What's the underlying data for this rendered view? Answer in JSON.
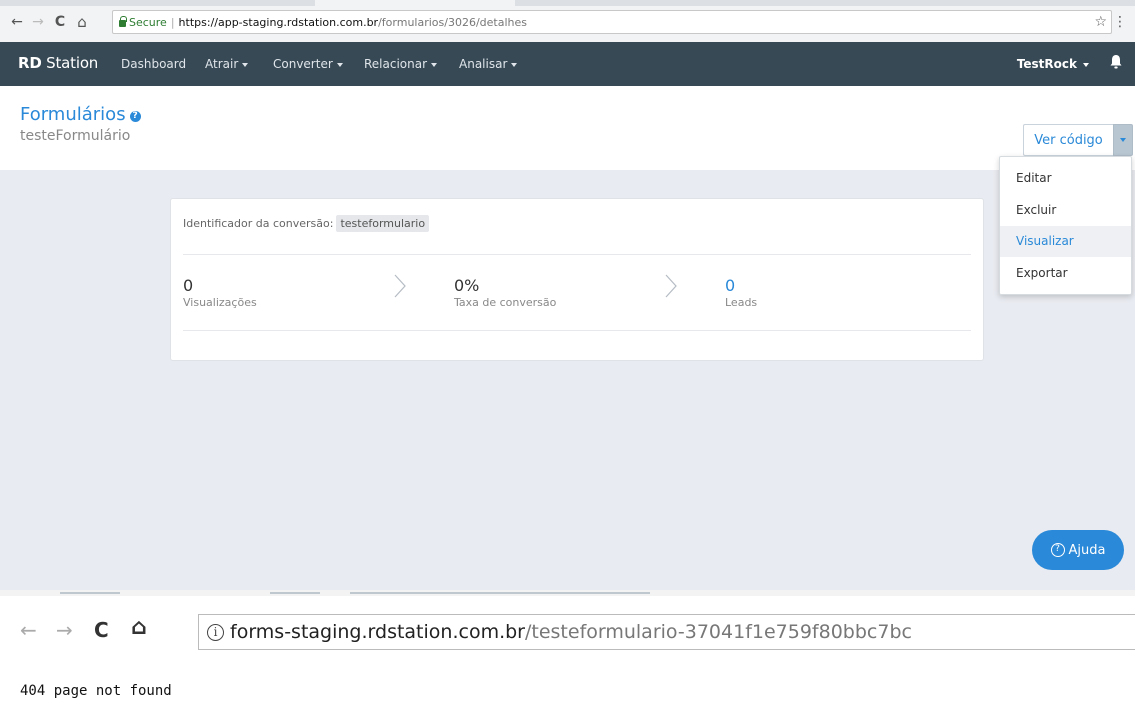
{
  "browser": {
    "secure_label": "Secure",
    "url_host": "https://app-staging.rdstation.com.br",
    "url_path": "/formularios/3026/detalhes",
    "back": "←",
    "forward": "→",
    "reload": "C",
    "home": "⌂",
    "star": "☆",
    "menu": "⋮"
  },
  "appbar": {
    "brand_bold": "RD",
    "brand_rest": " Station",
    "nav": [
      "Dashboard",
      "Atrair",
      "Converter",
      "Relacionar",
      "Analisar"
    ],
    "user": "TestRock"
  },
  "header": {
    "title": "Formulários",
    "help_glyph": "?",
    "subtitle": "testeFormulário",
    "action_label": "Ver código"
  },
  "dropdown": {
    "items": [
      "Editar",
      "Excluir",
      "Visualizar",
      "Exportar"
    ],
    "active_index": 2
  },
  "card": {
    "conversion_label": "Identificador da conversão:",
    "conversion_id": "testeformulario",
    "metrics": [
      {
        "value": "0",
        "label": "Visualizações"
      },
      {
        "value": "0%",
        "label": "Taxa de conversão"
      },
      {
        "value": "0",
        "label": "Leads"
      }
    ]
  },
  "help_button": {
    "glyph": "?",
    "label": "Ajuda"
  },
  "browser2": {
    "info_glyph": "i",
    "url_host": "forms-staging.rdstation.com.br",
    "url_path": "/testeformulario-37041f1e759f80bbc7bc",
    "back": "←",
    "forward": "→",
    "reload": "C",
    "home": "⌂"
  },
  "error_text": "404 page not found",
  "colors": {
    "navbar": "#374955",
    "accent": "#2a89d8",
    "content_bg": "#e8ebf1"
  }
}
